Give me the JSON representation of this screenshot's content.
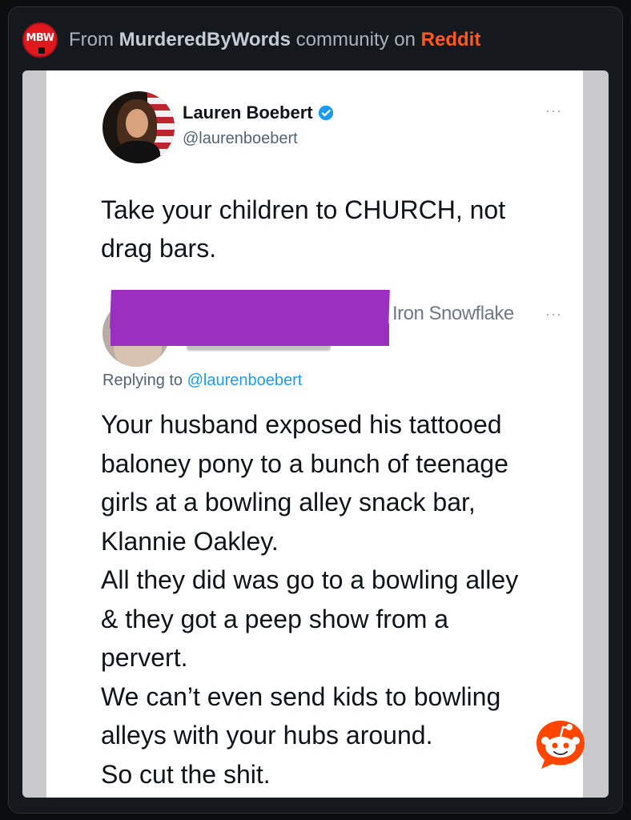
{
  "header": {
    "badge_text": "MBW",
    "prefix": "From ",
    "subreddit": "MurderedByWords",
    "middle": " community on ",
    "platform": "Reddit"
  },
  "tweet": {
    "name": "Lauren Boebert",
    "handle": "@laurenboebert",
    "more": "···",
    "lines": [
      "Take your children to CHURCH, not",
      "drag bars."
    ]
  },
  "reply": {
    "display_name": "Iron Snowflake",
    "more": "···",
    "replying_prefix": "Replying to ",
    "replying_mention": "@laurenboebert",
    "lines": [
      "Your husband exposed his tattooed",
      "baloney pony to a bunch of teenage",
      "girls at a bowling alley snack bar,",
      "Klannie Oakley.",
      "All they did was go to a bowling alley",
      "& they got a peep show from a",
      "pervert.",
      "We can’t even send kids to bowling",
      "alleys with your hubs around.",
      "So cut the shit."
    ]
  },
  "colors": {
    "reddit_orange": "#ff5a1f",
    "twitter_blue": "#1d9bf0",
    "redaction_purple": "#9b2fc0"
  },
  "icons": [
    "subreddit-badge-icon",
    "verified-icon",
    "more-icon",
    "snoo-icon"
  ]
}
